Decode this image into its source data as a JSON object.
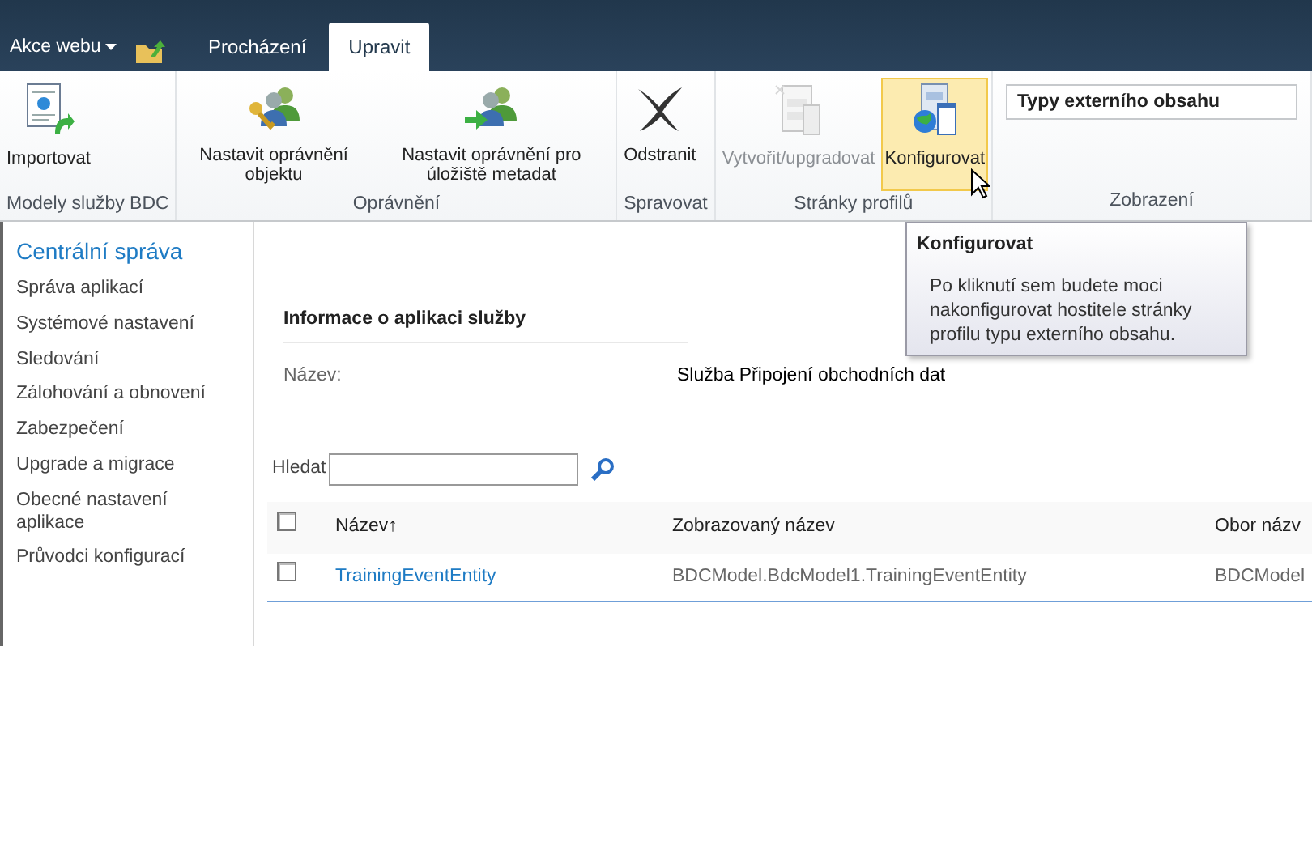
{
  "top_bar": {
    "site_actions": "Akce webu",
    "tabs": [
      {
        "label": "Procházení",
        "selected": false
      },
      {
        "label": "Upravit",
        "selected": true
      }
    ]
  },
  "ribbon": {
    "groups": [
      {
        "label": "Modely služby BDC",
        "buttons": [
          {
            "label": "Importovat",
            "disabled": false,
            "highlighted": false
          }
        ]
      },
      {
        "label": "Oprávnění",
        "buttons": [
          {
            "label": "Nastavit oprávnění objektu",
            "disabled": false,
            "highlighted": false
          },
          {
            "label": "Nastavit oprávnění pro úložiště metadat",
            "disabled": false,
            "highlighted": false
          }
        ]
      },
      {
        "label": "Spravovat",
        "buttons": [
          {
            "label": "Odstranit",
            "disabled": false,
            "highlighted": false
          }
        ]
      },
      {
        "label": "Stránky profilů",
        "buttons": [
          {
            "label": "Vytvořit/upgradovat",
            "disabled": true,
            "highlighted": false
          },
          {
            "label": "Konfigurovat",
            "disabled": false,
            "highlighted": true
          }
        ]
      },
      {
        "label": "Zobrazení",
        "select": "Typy externího obsahu"
      }
    ]
  },
  "tooltip": {
    "title": "Konfigurovat",
    "text": "Po kliknutí sem budete moci nakonfigurovat hostitele stránky profilu typu externího obsahu."
  },
  "sidebar": {
    "heading": "Centrální správa",
    "items": [
      "Správa aplikací",
      "Systémové nastavení",
      "Sledování",
      "Zálohování a obnovení",
      "Zabezpečení",
      "Upgrade a migrace",
      "Obecné nastavení aplikace",
      "Průvodci konfigurací"
    ]
  },
  "section": {
    "title": "Informace o aplikaci služby",
    "label": "Název:",
    "value": "Služba Připojení obchodních dat"
  },
  "search": {
    "label": "Hledat"
  },
  "table": {
    "header_checked": false,
    "columns": [
      "Název↑",
      "Zobrazovaný název",
      "Obor názv"
    ],
    "rows": [
      {
        "checked": false,
        "cells": [
          "TrainingEventEntity",
          "BDCModel.BdcModel1.TrainingEventEntity",
          "BDCModel"
        ]
      }
    ]
  }
}
